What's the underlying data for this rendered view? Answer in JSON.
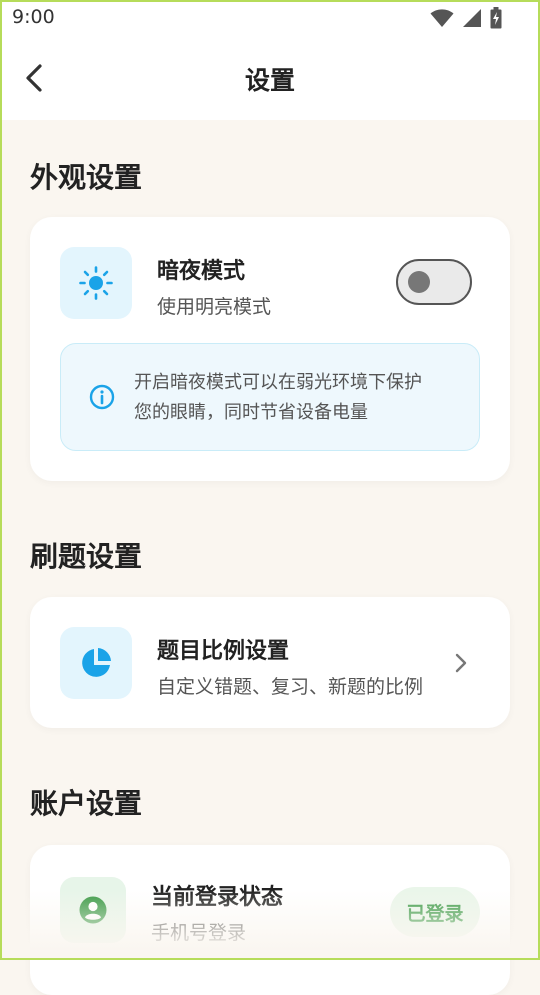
{
  "status_bar": {
    "time": "9:00",
    "icons": [
      "wifi-icon",
      "signal-icon",
      "battery-charging-icon"
    ]
  },
  "app_bar": {
    "back_icon": "chevron-left-icon",
    "title": "设置"
  },
  "sections": {
    "appearance": {
      "title": "外观设置",
      "dark_mode": {
        "icon": "sun-icon",
        "title": "暗夜模式",
        "subtitle": "使用明亮模式",
        "enabled": false,
        "info_icon": "info-icon",
        "info_line1": "开启暗夜模式可以在弱光环境下保护",
        "info_line2": "您的眼睛，同时节省设备电量"
      }
    },
    "practice": {
      "title": "刷题设置",
      "ratio": {
        "icon": "pie-chart-icon",
        "title": "题目比例设置",
        "subtitle": "自定义错题、复习、新题的比例",
        "chevron_icon": "chevron-right-icon"
      }
    },
    "account": {
      "title": "账户设置",
      "login": {
        "icon": "user-circle-icon",
        "title": "当前登录状态",
        "subtitle": "手机号登录",
        "badge": "已登录"
      }
    }
  },
  "colors": {
    "background": "#faf6f0",
    "accent_blue": "#1aa3e8",
    "accent_green": "#3c9a47",
    "icon_tile_blue": "#e3f5fd",
    "icon_tile_green": "#e7f5e9"
  }
}
